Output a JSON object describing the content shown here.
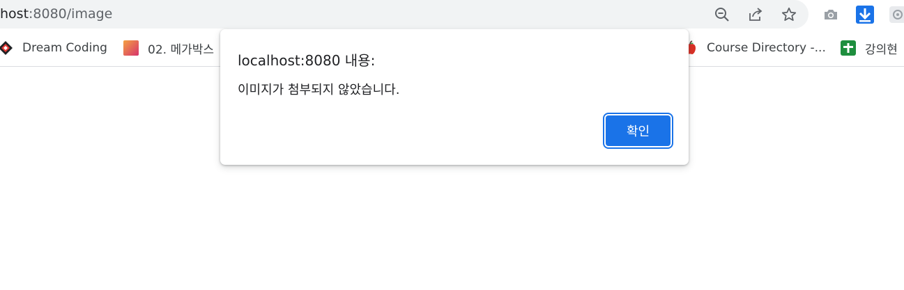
{
  "browser": {
    "url_host": "host",
    "url_rest": ":8080/image",
    "toolbar_icons": [
      "zoom-out-icon",
      "share-icon",
      "star-icon",
      "camera-icon",
      "download-icon",
      "extension-icon"
    ]
  },
  "bookmarks": [
    {
      "label": "Dream Coding",
      "icon": "dream-coding-icon"
    },
    {
      "label": "02. 메가박스",
      "icon": "gradient-square-icon"
    },
    {
      "label": "Course Directory -...",
      "icon": "apple-icon"
    },
    {
      "label": "강의현",
      "icon": "green-sheet-icon"
    }
  ],
  "dialog": {
    "title": "localhost:8080 내용:",
    "message": "이미지가 첨부되지 않았습니다.",
    "ok_label": "확인"
  },
  "colors": {
    "accent": "#1a73e8",
    "omnibox": "#f1f3f4"
  }
}
